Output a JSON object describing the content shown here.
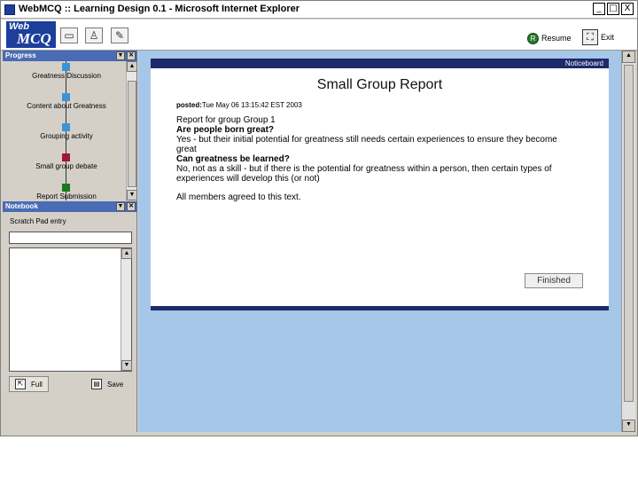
{
  "window": {
    "title": "WebMCQ :: Learning Design 0.1 - Microsoft Internet Explorer",
    "minimize": "_",
    "maximize": "□",
    "close": "X"
  },
  "toolbar": {
    "logo_web": "Web",
    "logo_mcq": "MCQ",
    "resume_label": "Resume",
    "exit_label": "Exit"
  },
  "progress": {
    "heading": "Progress",
    "items": [
      {
        "label": "Greatness Discussion",
        "color": "#3b93d6"
      },
      {
        "label": "Content about Greatness",
        "color": "#3b93d6"
      },
      {
        "label": "Grouping activity",
        "color": "#3b93d6"
      },
      {
        "label": "Small group debate",
        "color": "#a0173a"
      },
      {
        "label": "Report Submission",
        "color": "#1a7a1a"
      }
    ]
  },
  "notebook": {
    "heading": "Notebook",
    "scratch_title": "Scratch Pad entry",
    "input_value": "",
    "text_value": "",
    "full_label": "Full",
    "save_label": "Save"
  },
  "main": {
    "noticeboard_label": "Noticeboard",
    "report_title": "Small Group Report",
    "posted_label": "posted:",
    "posted_value": "Tue May 06 13:15:42 EST 2003",
    "intro": "Report for group Group 1",
    "q1": "Are people born great?",
    "a1": "Yes - but their initial potential for greatness still needs certain experiences to ensure they become great",
    "q2": "Can greatness be learned?",
    "a2": "No, not as a skill - but if there is the potential for greatness within a person, then certain types of experiences will develop this (or not)",
    "agreement": "All members agreed to this text.",
    "finished_label": "Finished"
  }
}
